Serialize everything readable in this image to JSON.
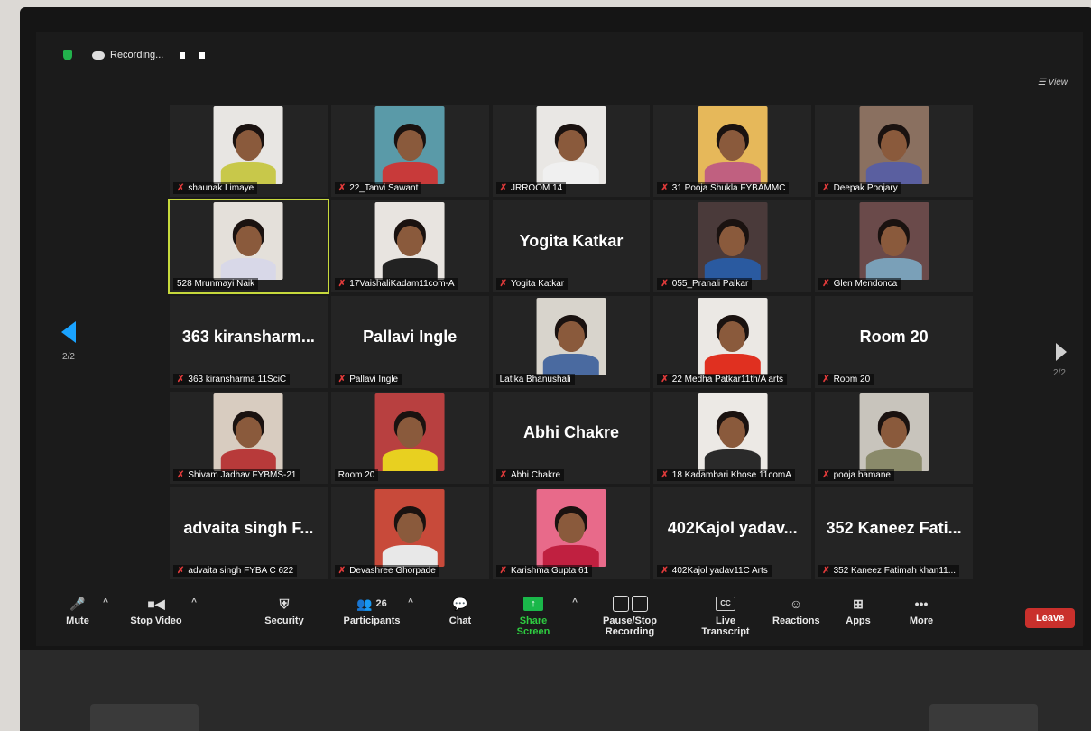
{
  "topbar": {
    "recording_label": "Recording..."
  },
  "view_label": "View",
  "pages": {
    "left": "2/2",
    "right": "2/2"
  },
  "tiles": [
    {
      "name": "shaunak Limaye",
      "big": "",
      "video": true,
      "bg": "#e8e6e3",
      "shirt": "#c8c84a"
    },
    {
      "name": "22_Tanvi Sawant",
      "big": "",
      "video": true,
      "bg": "#5a9aa8",
      "shirt": "#c83a3a"
    },
    {
      "name": "JRROOM 14",
      "big": "",
      "video": true,
      "bg": "#e9e7e4",
      "shirt": "#f0f0f0"
    },
    {
      "name": "31 Pooja Shukla FYBAMMC",
      "big": "",
      "video": true,
      "bg": "#e6b85a",
      "shirt": "#c06080"
    },
    {
      "name": "Deepak Poojary",
      "big": "",
      "video": true,
      "bg": "#8a7060",
      "shirt": "#5a5fa0"
    },
    {
      "name": "528 Mrunmayi Naik",
      "big": "",
      "video": true,
      "bg": "#e4e0da",
      "shirt": "#d8d8e8",
      "active": true
    },
    {
      "name": "17VaishaliKadam11com-A",
      "big": "",
      "video": true,
      "bg": "#e8e4e0",
      "shirt": "#222222"
    },
    {
      "name": "Yogita Katkar",
      "big": "Yogita Katkar",
      "video": false
    },
    {
      "name": "055_Pranali Palkar",
      "big": "",
      "video": true,
      "bg": "#4a3a3a",
      "shirt": "#2a5aa0"
    },
    {
      "name": "Glen Mendonca",
      "big": "",
      "video": true,
      "bg": "#6a4a4a",
      "shirt": "#7aa0b8"
    },
    {
      "name": "363 kiransharma 11SciC",
      "big": "363  kiransharm...",
      "video": false
    },
    {
      "name": "Pallavi Ingle",
      "big": "Pallavi Ingle",
      "video": false
    },
    {
      "name": "Latika Bhanushali",
      "big": "",
      "video": true,
      "bg": "#d8d4cc",
      "shirt": "#4a6aa0"
    },
    {
      "name": "22 Medha Patkar11th/A arts",
      "big": "",
      "video": true,
      "bg": "#ebe8e4",
      "shirt": "#e03020"
    },
    {
      "name": "Room 20",
      "big": "Room 20",
      "video": false
    },
    {
      "name": "Shivam Jadhav FYBMS-21",
      "big": "",
      "video": true,
      "bg": "#d8ccc0",
      "shirt": "#b83a3a"
    },
    {
      "name": "Room 20",
      "big": "",
      "video": true,
      "bg": "#b84040",
      "shirt": "#e8d020"
    },
    {
      "name": "Abhi Chakre",
      "big": "Abhi Chakre",
      "video": false
    },
    {
      "name": "18 Kadambari Khose 11comA",
      "big": "",
      "video": true,
      "bg": "#ece9e5",
      "shirt": "#2a2a2a"
    },
    {
      "name": "pooja bamane",
      "big": "",
      "video": true,
      "bg": "#c8c4bc",
      "shirt": "#8a8a6a"
    },
    {
      "name": "advaita singh FYBA C 622",
      "big": "advaita  singh  F...",
      "video": false
    },
    {
      "name": "Devashree Ghorpade",
      "big": "",
      "video": true,
      "bg": "#c84a3a",
      "shirt": "#e8e8e8"
    },
    {
      "name": "Karishma Gupta 61",
      "big": "",
      "video": true,
      "bg": "#e86a8a",
      "shirt": "#c02040"
    },
    {
      "name": "402Kajol yadav11C Arts",
      "big": "402Kajol  yadav...",
      "video": false
    },
    {
      "name": "352 Kaneez Fatimah khan11...",
      "big": "352  Kaneez  Fati...",
      "video": false
    }
  ],
  "toolbar": {
    "mute": "Mute",
    "stop_video": "Stop Video",
    "security": "Security",
    "participants": "Participants",
    "participants_count": "26",
    "chat": "Chat",
    "share_screen": "Share Screen",
    "pause_stop": "Pause/Stop Recording",
    "live_transcript": "Live Transcript",
    "reactions": "Reactions",
    "apps": "Apps",
    "more": "More",
    "leave": "Leave",
    "cc": "CC"
  }
}
